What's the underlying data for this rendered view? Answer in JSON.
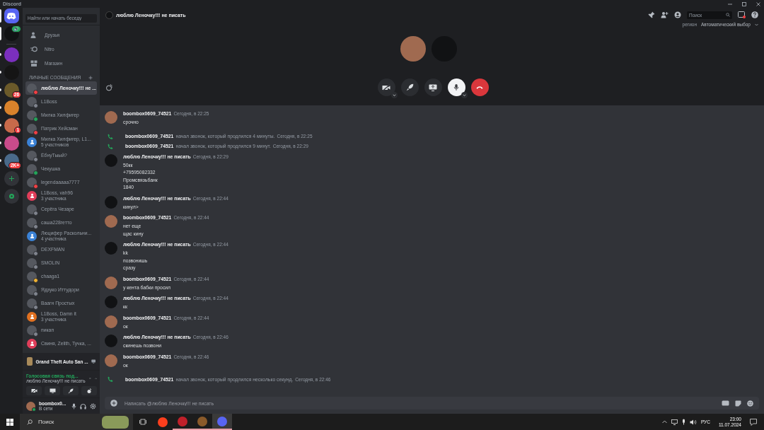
{
  "window": {
    "title": "Discord"
  },
  "servers": [
    {
      "kind": "home",
      "selected": true,
      "unread": false,
      "color": "#5865f2"
    },
    {
      "kind": "avatar",
      "selected": true,
      "unread": false,
      "color": "#111214",
      "badge": "🔊"
    },
    {
      "kind": "avatar",
      "selected": false,
      "unread": true,
      "color": "#7b2fbe"
    },
    {
      "kind": "avatar",
      "selected": false,
      "unread": true,
      "color": "#151515"
    },
    {
      "kind": "avatar",
      "selected": false,
      "unread": true,
      "color": "#6b5a2a",
      "badge": "26"
    },
    {
      "kind": "avatar",
      "selected": false,
      "unread": true,
      "color": "#d9822b"
    },
    {
      "kind": "avatar",
      "selected": false,
      "unread": true,
      "color": "#c86a4a",
      "badge": "1"
    },
    {
      "kind": "avatar",
      "selected": false,
      "unread": true,
      "color": "#c94b8a"
    },
    {
      "kind": "avatar",
      "selected": false,
      "unread": true,
      "color": "#4a6a8a",
      "badge": "2K+"
    },
    {
      "kind": "add",
      "color": "#313338"
    },
    {
      "kind": "discover",
      "color": "#313338"
    }
  ],
  "dm_search": {
    "placeholder": "Найти или начать беседу"
  },
  "nav": [
    {
      "kind": "friends",
      "label": "Друзья"
    },
    {
      "kind": "nitro",
      "label": "Nitro"
    },
    {
      "kind": "shop",
      "label": "Магазин"
    }
  ],
  "dm_heading": "ЛИЧНЫЕ СООБЩЕНИЯ",
  "dms": [
    {
      "name": "люблю Леночку!!! не ...",
      "kind": "user",
      "color": "#f23f43",
      "selected": true
    },
    {
      "name": "L1Boss",
      "kind": "user",
      "color": "#80848e",
      "selected": false
    },
    {
      "name": "Милка Хилфигер",
      "kind": "user",
      "color": "#23a55a",
      "selected": false
    },
    {
      "name": "Патрик Хейсман",
      "kind": "user",
      "color": "#f23f43",
      "selected": false
    },
    {
      "name": "Милка Хилфигер, L1...",
      "subtitle": "5 участников",
      "kind": "group",
      "color": "#3b82d6",
      "selected": false
    },
    {
      "name": "ЁбнуТыый?",
      "kind": "user",
      "color": "#80848e",
      "selected": false
    },
    {
      "name": "Чекушка",
      "kind": "user",
      "color": "#23a55a",
      "selected": false
    },
    {
      "name": "legendaaaaa7777",
      "kind": "user",
      "color": "#f23f43",
      "selected": false
    },
    {
      "name": "L1Boss, vah96",
      "subtitle": "3 участника",
      "kind": "group",
      "color": "#e03e5a",
      "selected": false
    },
    {
      "name": "Серёга Чезаре",
      "kind": "user",
      "color": "#80848e",
      "selected": false
    },
    {
      "name": "саша228гетто",
      "kind": "user",
      "color": "#80848e",
      "selected": false
    },
    {
      "name": "Люцифер Раскольни...",
      "subtitle": "4 участника",
      "kind": "group",
      "color": "#3b82d6",
      "selected": false
    },
    {
      "name": "DEXFMAN",
      "kind": "user",
      "color": "#80848e",
      "selected": false
    },
    {
      "name": "SMOLIN",
      "kind": "user",
      "color": "#80848e",
      "selected": false
    },
    {
      "name": "chaaga1",
      "kind": "user",
      "color": "#f0b232",
      "selected": false
    },
    {
      "name": "Ядзуко Иттудори",
      "kind": "user",
      "color": "#80848e",
      "selected": false
    },
    {
      "name": "Ваагн Простых",
      "kind": "user",
      "color": "#80848e",
      "selected": false
    },
    {
      "name": "L1Boss, Damn it",
      "subtitle": "3 участника",
      "kind": "group",
      "color": "#e07020",
      "selected": false
    },
    {
      "name": "пикап",
      "kind": "user",
      "color": "#80848e",
      "selected": false
    },
    {
      "name": "Свиня, Zelith, Тучка, ...",
      "kind": "group",
      "color": "#e03e5a",
      "selected": false
    }
  ],
  "activity": {
    "title": "Grand Theft Auto San ..."
  },
  "voice": {
    "status": "Голосовая связь под...",
    "channel": "люблю Леночку!!! не писать"
  },
  "user": {
    "name": "boombox0...",
    "status": "В сети"
  },
  "header": {
    "title": "люблю Леночку!!! не писать",
    "search": {
      "placeholder": "Поиск"
    },
    "region_label": "регион",
    "region_value": "Автоматический выбор"
  },
  "call": {
    "participants": [
      {
        "color": "#a06a50"
      },
      {
        "color": "#111214"
      }
    ],
    "camera_on": false,
    "mic_muted": false
  },
  "messages": [
    {
      "kind": "message",
      "author": "boombox0609_74521",
      "time": "Сегодня, в 22:25",
      "color": "#a06a50",
      "lines": [
        "срочно"
      ]
    },
    {
      "kind": "call",
      "author": "boombox0609_74521",
      "text": "начал звонок, который продлился 4 минуты.",
      "time": "Сегодня, в 22:25"
    },
    {
      "kind": "call",
      "author": "boombox0609_74521",
      "text": "начал звонок, который продлился 9 минут.",
      "time": "Сегодня, в 22:29"
    },
    {
      "kind": "message",
      "author": "люблю Леночку!!! не писать",
      "time": "Сегодня, в 22:29",
      "color": "#111214",
      "lines": [
        "50кк",
        "+79595082332",
        "Промсвязьбанк",
        "1840"
      ]
    },
    {
      "kind": "message",
      "author": "люблю Леночку!!! не писать",
      "time": "Сегодня, в 22:44",
      "color": "#111214",
      "lines": [
        "кинул>"
      ]
    },
    {
      "kind": "message",
      "author": "boombox0609_74521",
      "time": "Сегодня, в 22:44",
      "color": "#a06a50",
      "lines": [
        "нет еще",
        "щас кину"
      ]
    },
    {
      "kind": "message",
      "author": "люблю Леночку!!! не писать",
      "time": "Сегодня, в 22:44",
      "color": "#111214",
      "lines": [
        "kk",
        "позвонишь",
        "сразу"
      ]
    },
    {
      "kind": "message",
      "author": "boombox0609_74521",
      "time": "Сегодня, в 22:44",
      "color": "#a06a50",
      "lines": [
        "у кента бабки просил"
      ]
    },
    {
      "kind": "message",
      "author": "люблю Леночку!!! не писать",
      "time": "Сегодня, в 22:44",
      "color": "#111214",
      "lines": [
        "кк"
      ]
    },
    {
      "kind": "message",
      "author": "boombox0609_74521",
      "time": "Сегодня, в 22:44",
      "color": "#a06a50",
      "lines": [
        "ок"
      ]
    },
    {
      "kind": "message",
      "author": "люблю Леночку!!! не писать",
      "time": "Сегодня, в 22:46",
      "color": "#111214",
      "lines": [
        "скинешь позвони"
      ]
    },
    {
      "kind": "message",
      "author": "boombox0609_74521",
      "time": "Сегодня, в 22:46",
      "color": "#a06a50",
      "lines": [
        "ок"
      ]
    },
    {
      "kind": "call",
      "author": "boombox0609_74521",
      "text": "начал звонок, который продлился несколько секунд.",
      "time": "Сегодня, в 22:46"
    }
  ],
  "composer": {
    "placeholder": "Написать @люблю Леночку!!! не писать"
  },
  "taskbar": {
    "search": {
      "placeholder": "Поиск"
    },
    "apps": [
      {
        "kind": "tasks",
        "active": false
      },
      {
        "kind": "yandex",
        "active": false
      },
      {
        "kind": "video",
        "active": true
      },
      {
        "kind": "game",
        "active": true
      },
      {
        "kind": "discord",
        "active": true
      }
    ],
    "language": "РУС",
    "time": "23:00",
    "date": "11.07.2024"
  }
}
